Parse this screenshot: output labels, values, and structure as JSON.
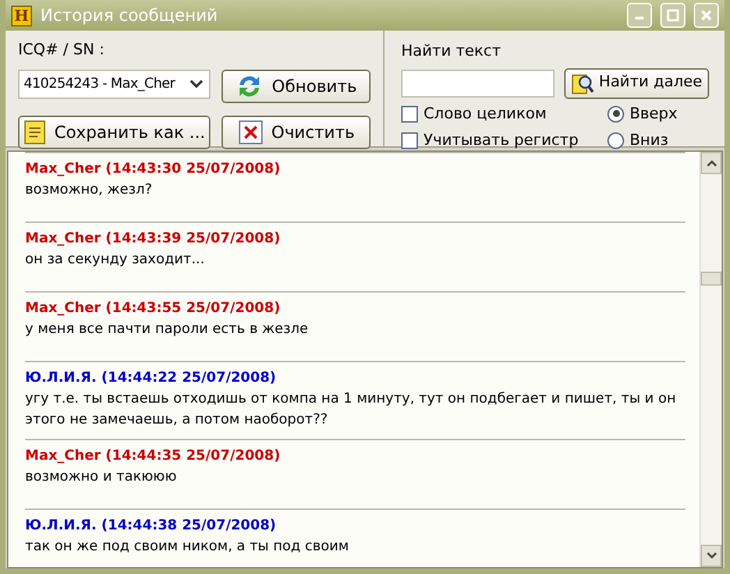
{
  "window": {
    "title": "История сообщений",
    "icon_letter": "H"
  },
  "contact": {
    "label": "ICQ# / SN :",
    "value": "410254243 - Max_Cher"
  },
  "buttons": [
    {
      "kind": "refresh",
      "label": "Обновить"
    },
    {
      "kind": "save",
      "label": "Сохранить как ..."
    },
    {
      "kind": "clear",
      "label": "Очистить"
    }
  ],
  "search": {
    "label": "Найти текст",
    "button": "Найти далее",
    "options": [
      {
        "label": "Слово целиком",
        "checked": false
      },
      {
        "label": "Учитывать регистр",
        "checked": false
      }
    ],
    "direction": [
      {
        "label": "Вверх",
        "selected": true
      },
      {
        "label": "Вниз",
        "selected": false
      }
    ]
  },
  "messages": [
    {
      "header": "Max_Cher (14:43:30 25/07/2008)",
      "color": "#cc0000",
      "text": "возможно, жезл?"
    },
    {
      "header": "Max_Cher (14:43:39 25/07/2008)",
      "color": "#cc0000",
      "text": "он за секунду заходит..."
    },
    {
      "header": "Max_Cher (14:43:55 25/07/2008)",
      "color": "#cc0000",
      "text": "у меня все пачти пароли есть в жезле"
    },
    {
      "header": "Ю.Л.И.Я. (14:44:22 25/07/2008)",
      "color": "#0000cc",
      "text": "угу т.е. ты встаешь отходишь от компа на 1 минуту, тут он подбегает и пишет, ты и он этого не замечаешь, а потом наоборот??"
    },
    {
      "header": "Max_Cher (14:44:35 25/07/2008)",
      "color": "#cc0000",
      "text": "возможно и такююю"
    },
    {
      "header": "Ю.Л.И.Я. (14:44:38 25/07/2008)",
      "color": "#0000cc",
      "text": "так он же под своим ником, а ты под своим"
    }
  ]
}
